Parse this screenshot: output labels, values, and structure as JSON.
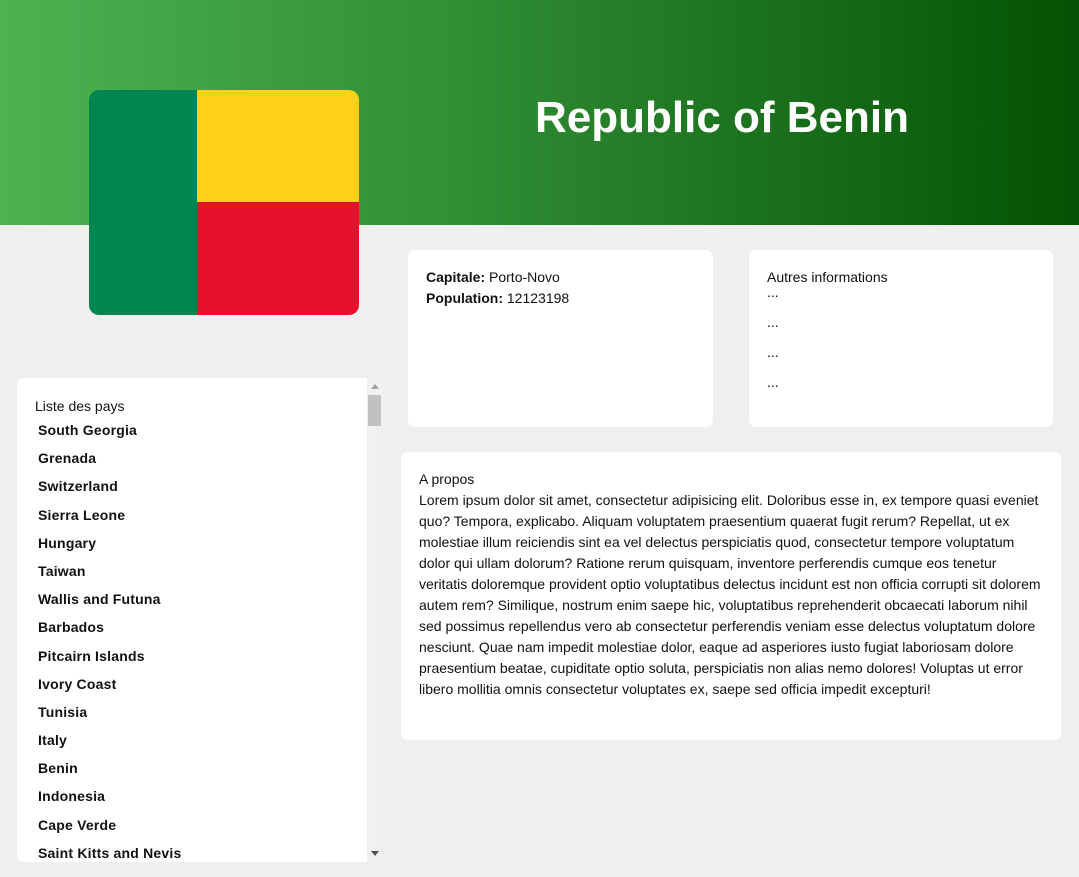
{
  "header": {
    "title": "Republic of Benin",
    "gradient_colors": [
      "#4cb350",
      "#035203"
    ]
  },
  "flag": {
    "icon": "benin-flag-icon",
    "colors": {
      "green": "#008751",
      "yellow": "#fcd116",
      "red": "#e8112d"
    }
  },
  "info": {
    "capital_label": "Capitale:",
    "capital_value": "Porto-Novo",
    "population_label": "Population:",
    "population_value": "12123198"
  },
  "other": {
    "title": "Autres informations",
    "items": [
      "...",
      "...",
      "...",
      "..."
    ]
  },
  "about": {
    "title": "A propos",
    "text": "Lorem ipsum dolor sit amet, consectetur adipisicing elit. Doloribus esse in, ex tempore quasi eveniet quo? Tempora, explicabo. Aliquam voluptatem praesentium quaerat fugit rerum? Repellat, ut ex molestiae illum reiciendis sint ea vel delectus perspiciatis quod, consectetur tempore voluptatum dolor qui ullam dolorum? Ratione rerum quisquam, inventore perferendis cumque eos tenetur veritatis doloremque provident optio voluptatibus delectus incidunt est non officia corrupti sit dolorem autem rem? Similique, nostrum enim saepe hic, voluptatibus reprehenderit obcaecati laborum nihil sed possimus repellendus vero ab consectetur perferendis veniam esse delectus voluptatum dolore nesciunt. Quae nam impedit molestiae dolor, eaque ad asperiores iusto fugiat laboriosam dolore praesentium beatae, cupiditate optio soluta, perspiciatis non alias nemo dolores! Voluptas ut error libero mollitia omnis consectetur voluptates ex, saepe sed officia impedit excepturi!"
  },
  "country_list": {
    "title": "Liste des pays",
    "items": [
      "South Georgia",
      "Grenada",
      "Switzerland",
      "Sierra Leone",
      "Hungary",
      "Taiwan",
      "Wallis and Futuna",
      "Barbados",
      "Pitcairn Islands",
      "Ivory Coast",
      "Tunisia",
      "Italy",
      "Benin",
      "Indonesia",
      "Cape Verde",
      "Saint Kitts and Nevis"
    ]
  }
}
